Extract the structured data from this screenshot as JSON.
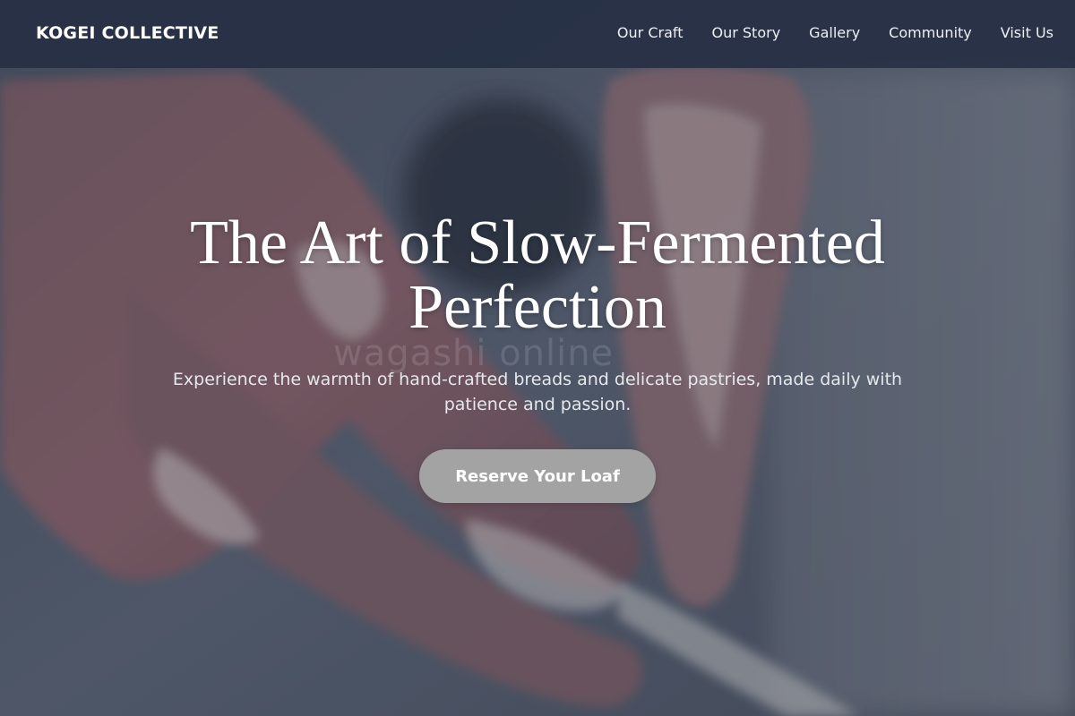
{
  "header": {
    "logo": "KOGEI COLLECTIVE",
    "nav": [
      {
        "label": "Our Craft"
      },
      {
        "label": "Our Story"
      },
      {
        "label": "Gallery"
      },
      {
        "label": "Community"
      },
      {
        "label": "Visit Us"
      }
    ]
  },
  "hero": {
    "title_line1": "The Art of Slow-Fermented",
    "title_line2": "Perfection",
    "subtitle": "Experience the warmth of hand-crafted breads and delicate pastries, made daily with patience and passion.",
    "cta_label": "Reserve Your Loaf",
    "watermark": "wagashi online"
  },
  "colors": {
    "header_bg": "#242e42",
    "cta_bg": "#a3a3a3",
    "text": "#ffffff"
  }
}
